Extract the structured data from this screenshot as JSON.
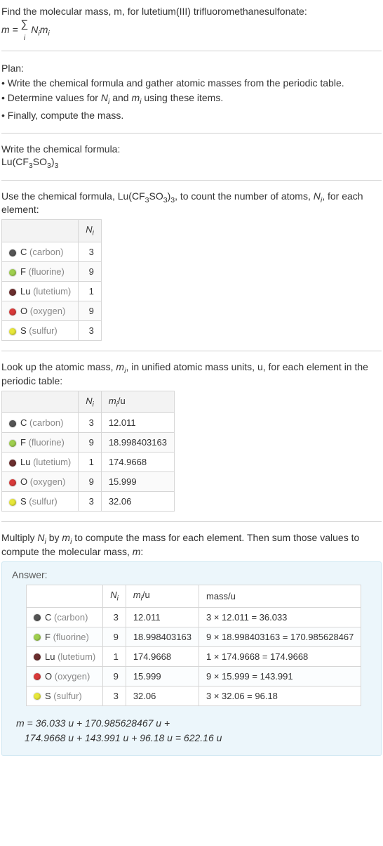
{
  "intro": {
    "line1": "Find the molecular mass, m, for lutetium(III) trifluoromethanesulfonate:",
    "eq_lhs": "m = ",
    "eq_sum": "∑",
    "eq_sub": "i",
    "eq_rhs": " N",
    "eq_rhs2": "m"
  },
  "plan": {
    "title": "Plan:",
    "b1a": "• Write the chemical formula and gather atomic masses from the periodic table.",
    "b2a": "• Determine values for ",
    "b2b": " and ",
    "b2c": " using these items.",
    "b3": "• Finally, compute the mass."
  },
  "step1": {
    "title": "Write the chemical formula:",
    "formula_a": "Lu(CF",
    "formula_b": "SO",
    "formula_c": ")",
    "s3a": "3",
    "s3b": "3",
    "s3c": "3"
  },
  "step2": {
    "text_a": "Use the chemical formula, Lu(CF",
    "text_b": "SO",
    "text_c": ")",
    "s3a": "3",
    "s3b": "3",
    "s3c": "3",
    "text_d": ", to count the number of atoms, ",
    "text_e": ", for each element:",
    "hdr_N": "N",
    "hdr_i": "i"
  },
  "elements": [
    {
      "color": "#555555",
      "sym": "C",
      "name": " (carbon)",
      "N": "3",
      "m": "12.011",
      "mass": "3 × 12.011 = 36.033"
    },
    {
      "color": "#9fcf4e",
      "sym": "F",
      "name": " (fluorine)",
      "N": "9",
      "m": "18.998403163",
      "mass": "9 × 18.998403163 = 170.985628467"
    },
    {
      "color": "#6b2e2e",
      "sym": "Lu",
      "name": " (lutetium)",
      "N": "1",
      "m": "174.9668",
      "mass": "1 × 174.9668 = 174.9668"
    },
    {
      "color": "#d93a3a",
      "sym": "O",
      "name": " (oxygen)",
      "N": "9",
      "m": "15.999",
      "mass": "9 × 15.999 = 143.991"
    },
    {
      "color": "#e7e73a",
      "sym": "S",
      "name": " (sulfur)",
      "N": "3",
      "m": "32.06",
      "mass": "3 × 32.06 = 96.18"
    }
  ],
  "step3": {
    "text_a": "Look up the atomic mass, ",
    "text_b": ", in unified atomic mass units, u, for each element in the periodic table:",
    "hdr_m": "m",
    "hdr_u": "/u"
  },
  "step4": {
    "text_a": "Multiply ",
    "text_b": " by ",
    "text_c": " to compute the mass for each element. Then sum those values to compute the molecular mass, ",
    "text_d": ":"
  },
  "answer": {
    "label": "Answer:",
    "hdr_mass": "mass/u",
    "final1": "m = 36.033 u + 170.985628467 u +",
    "final2": "174.9668 u + 143.991 u + 96.18 u = 622.16 u"
  }
}
